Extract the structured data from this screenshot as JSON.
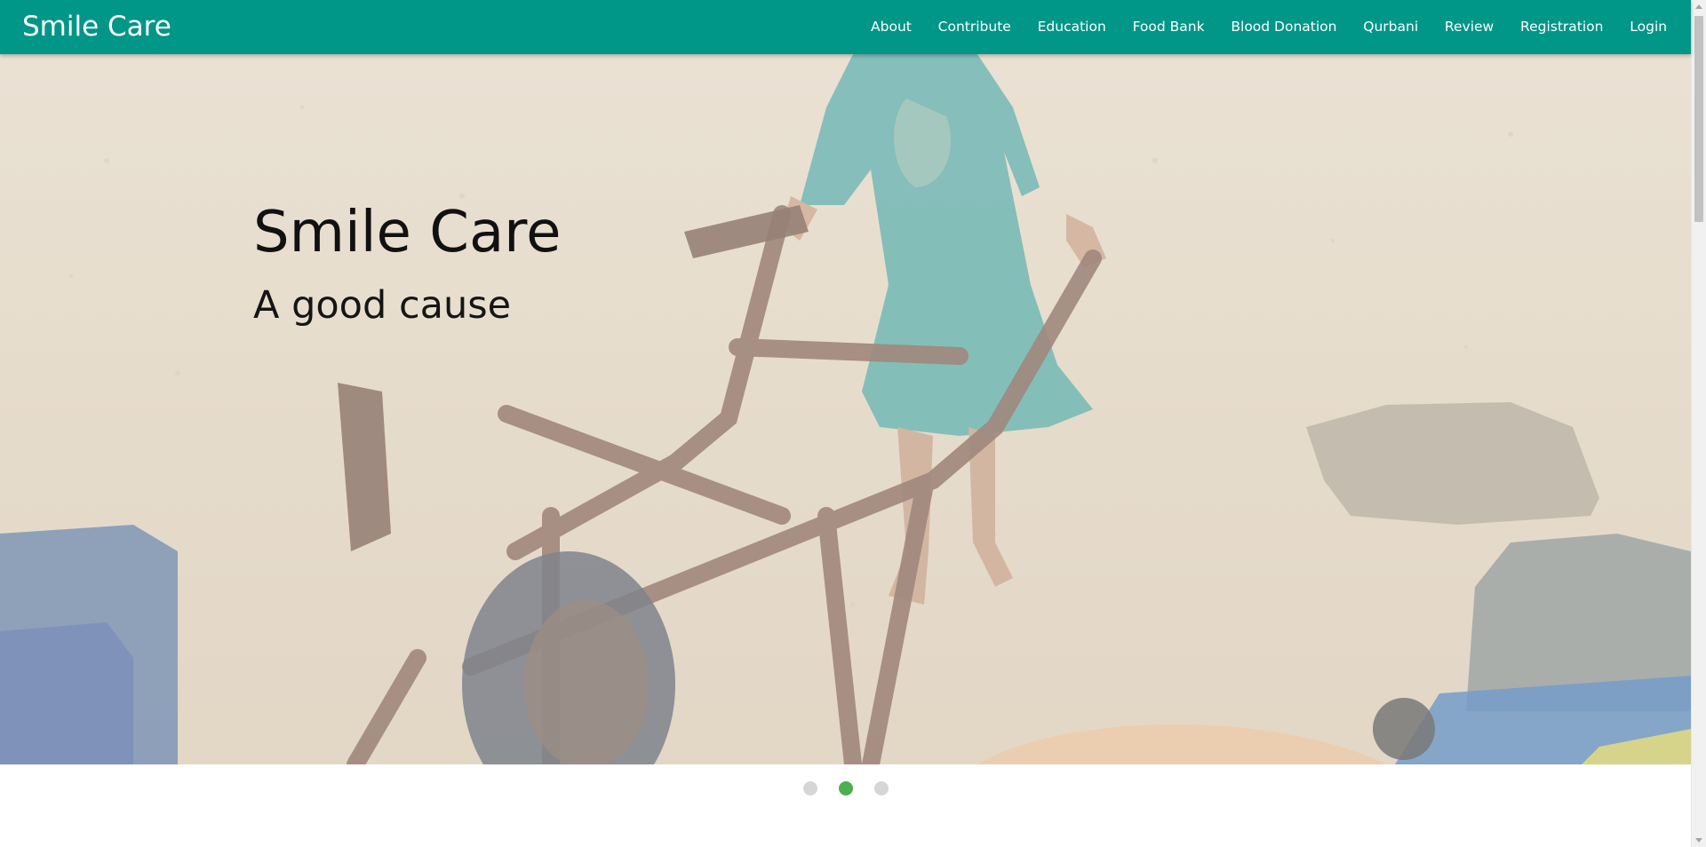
{
  "navbar": {
    "brand": "Smile Care",
    "links": [
      {
        "label": "About"
      },
      {
        "label": "Contribute"
      },
      {
        "label": "Education"
      },
      {
        "label": "Food Bank"
      },
      {
        "label": "Blood Donation"
      },
      {
        "label": "Qurbani"
      },
      {
        "label": "Review"
      },
      {
        "label": "Registration"
      },
      {
        "label": "Login"
      }
    ],
    "color": "#009688"
  },
  "hero": {
    "title": "Smile Care",
    "subtitle": "A good cause",
    "slide_count": 3,
    "active_slide": 2
  },
  "colors": {
    "indicator_active": "#4caf50",
    "indicator_inactive": "#d6d6d6"
  }
}
